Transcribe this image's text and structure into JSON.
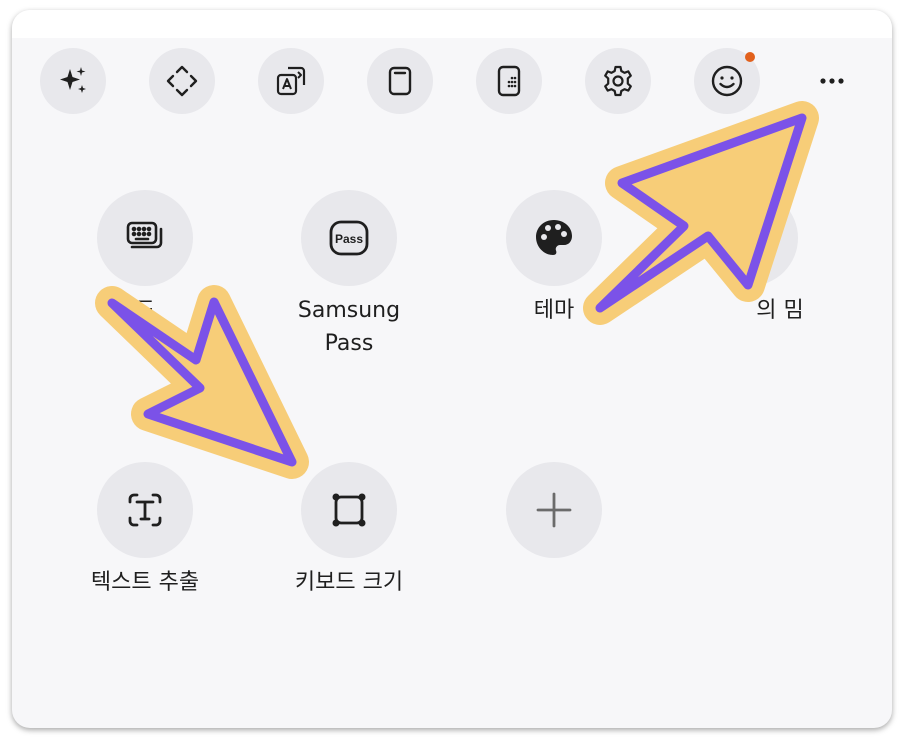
{
  "toolbar": {
    "buttons": [
      {
        "name": "ai-sparkle-icon"
      },
      {
        "name": "expand-arrows-icon"
      },
      {
        "name": "translate-icon"
      },
      {
        "name": "clipboard-icon"
      },
      {
        "name": "keypad-icon"
      },
      {
        "name": "settings-gear-icon"
      },
      {
        "name": "emoji-icon"
      },
      {
        "name": "more-options-icon"
      }
    ],
    "notification_dot_color": "#e2611d"
  },
  "grid": {
    "items": [
      {
        "label": "드",
        "icon": "keyboard-icon"
      },
      {
        "label": "Samsung\nPass",
        "icon": "pass-icon"
      },
      {
        "label": "테마",
        "icon": "palette-icon"
      },
      {
        "label": "의 밈",
        "icon": "meme-icon"
      },
      {
        "label": "텍스트 추출",
        "icon": "text-extract-icon"
      },
      {
        "label": "키보드 크기",
        "icon": "keyboard-size-icon"
      },
      {
        "label": "",
        "icon": "add-icon"
      }
    ]
  },
  "annotation": {
    "arrow_fill": "#f7cd78",
    "arrow_stroke": "#7b52e8"
  }
}
